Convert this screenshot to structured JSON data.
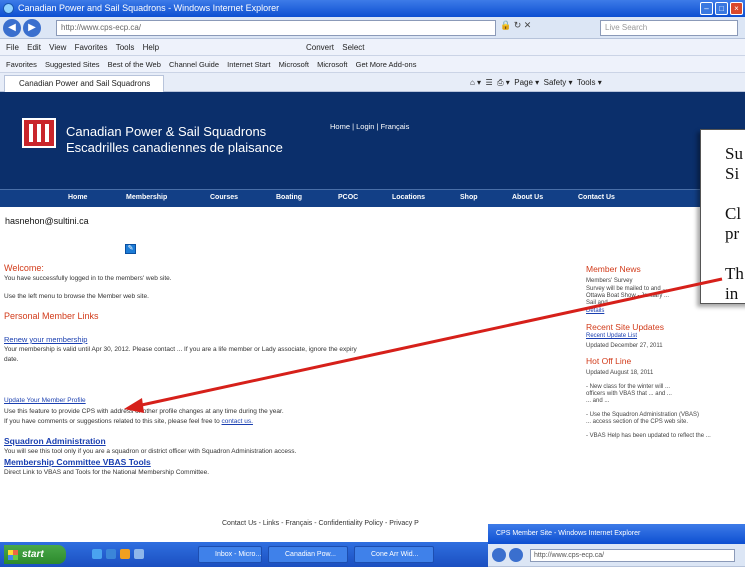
{
  "window": {
    "title": "Canadian Power and Sail Squadrons - Windows Internet Explorer"
  },
  "address_bar": {
    "url": "http://www.cps-ecp.ca/",
    "search_placeholder": "Live Search"
  },
  "menu": {
    "items": [
      "File",
      "Edit",
      "View",
      "Favorites",
      "Tools",
      "Help"
    ],
    "convert": "Convert",
    "select": "Select"
  },
  "favorites": {
    "items": [
      "Favorites",
      "Suggested Sites",
      "Best of the Web",
      "Channel Guide",
      "Internet Start",
      "Microsoft",
      "Microsoft",
      "Get More Add-ons"
    ]
  },
  "tab": {
    "label": "Canadian Power and Sail Squadrons"
  },
  "commands": {
    "items": [
      "Page",
      "Safety",
      "Tools"
    ]
  },
  "site": {
    "org_en": "Canadian Power & Sail Squadrons",
    "org_fr": "Escadrilles canadiennes de plaisance",
    "header_links": "Home | Login | Français",
    "nav": [
      "Home",
      "Membership",
      "Courses",
      "Boating",
      "PCOC",
      "Locations",
      "Shop",
      "About Us",
      "Contact Us"
    ]
  },
  "user": {
    "email": "hasnehon@sultini.ca"
  },
  "content": {
    "welcome_heading": "Welcome:",
    "welcome_text": "You have successfully logged in to the members' web site.",
    "menu_hint": "Use the left menu to browse the Member web site.",
    "links_heading": "Personal Member Links",
    "renew_link": "Renew your membership",
    "renew_text": "Your membership is valid until Apr 30, 2012. Please contact ... If you are a life member or Lady associate, ignore the expiry",
    "renew_text2": "date.",
    "update_link": "Update Your Member Profile",
    "update_text": "Use this feature to provide CPS with address or other profile changes at any time during the year.",
    "comments_text": "If you have comments or suggestions related to this site, please feel free to",
    "contact_link": "contact us.",
    "admin_link": "Squadron Administration",
    "admin_text": "You will see this tool only if you are a squadron or district officer with Squadron Administration access.",
    "committee_link": "Membership Committee VBAS Tools",
    "committee_text": "Direct Link to VBAS and Tools for the National Membership Committee.",
    "footer": "Contact Us - Links - Français - Confidentiality Policy - Privacy P"
  },
  "sidebar": {
    "news_heading": "Member News",
    "news_sub": "Members' Survey",
    "news_text": [
      "Survey will be mailed to and ...",
      "Ottawa Boat Show - January ...",
      "Sail and ..."
    ],
    "news_more": "Details",
    "updates_heading": "Recent Site Updates",
    "updates_link": "Recent Update List",
    "updates_date": "Updated December 27, 2011",
    "new_heading": "Hot Off Line",
    "new_date": "Updated August 18, 2011",
    "new_text": [
      "- New class for the winter will ...",
      "officers with VBAS that ... and ...",
      "... and ..."
    ],
    "admin_text": [
      "- Use the Squadron Administration (VBAS)",
      "... access section of the CPS web site."
    ],
    "vbas_text": "- VBAS Help has been updated to reflect the ..."
  },
  "callout": {
    "lines": [
      "Su",
      "Si",
      "",
      "Cl",
      "pr",
      "",
      "Th",
      "in"
    ]
  },
  "popup": {
    "title": "CPS Member Site - Windows Internet Explorer",
    "url": "http://www.cps-ecp.ca/"
  },
  "taskbar": {
    "start": "start",
    "tasks": [
      "Inbox - Micro...",
      "Canadian Pow...",
      "Cone Arr Wid..."
    ]
  },
  "colors": {
    "header_bg": "#0b2f6b",
    "accent_red": "#d23b1a",
    "link_blue": "#1a3fb0",
    "arrow_red": "#d6201a"
  }
}
